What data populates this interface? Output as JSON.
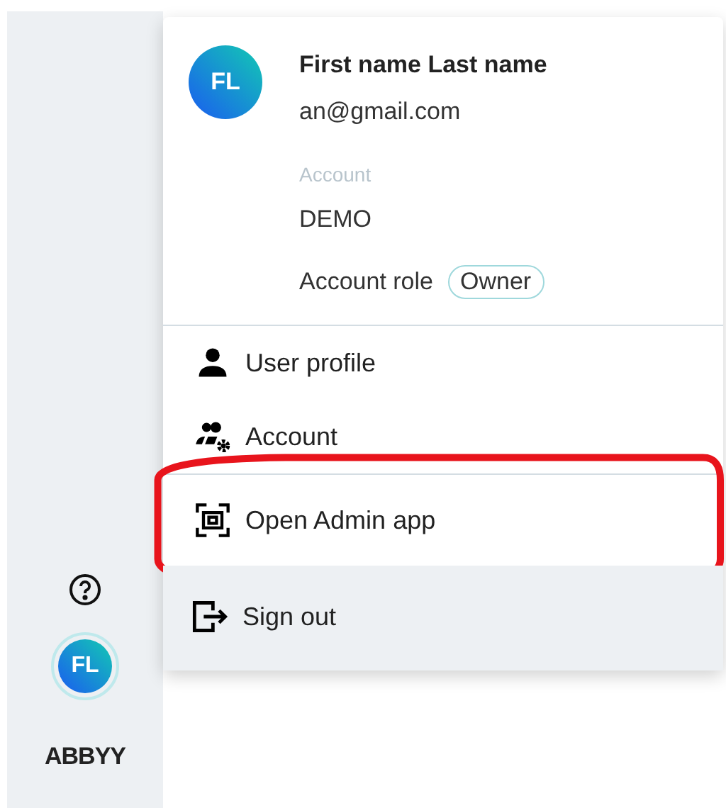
{
  "sidebar": {
    "avatar_initials": "FL",
    "logo": "ABBYY"
  },
  "user_menu": {
    "avatar_initials": "FL",
    "name": "First name Last name",
    "email": "an@gmail.com",
    "account_label": "Account",
    "account_name": "DEMO",
    "role_label": "Account role",
    "role_badge": "Owner",
    "items": [
      {
        "kind": "profile",
        "label": "User profile",
        "highlighted": false
      },
      {
        "kind": "account",
        "label": "Account",
        "highlighted": false
      },
      {
        "kind": "admin",
        "label": "Open Admin app",
        "highlighted": true
      },
      {
        "kind": "signout",
        "label": "Sign out",
        "highlighted": false
      }
    ]
  }
}
